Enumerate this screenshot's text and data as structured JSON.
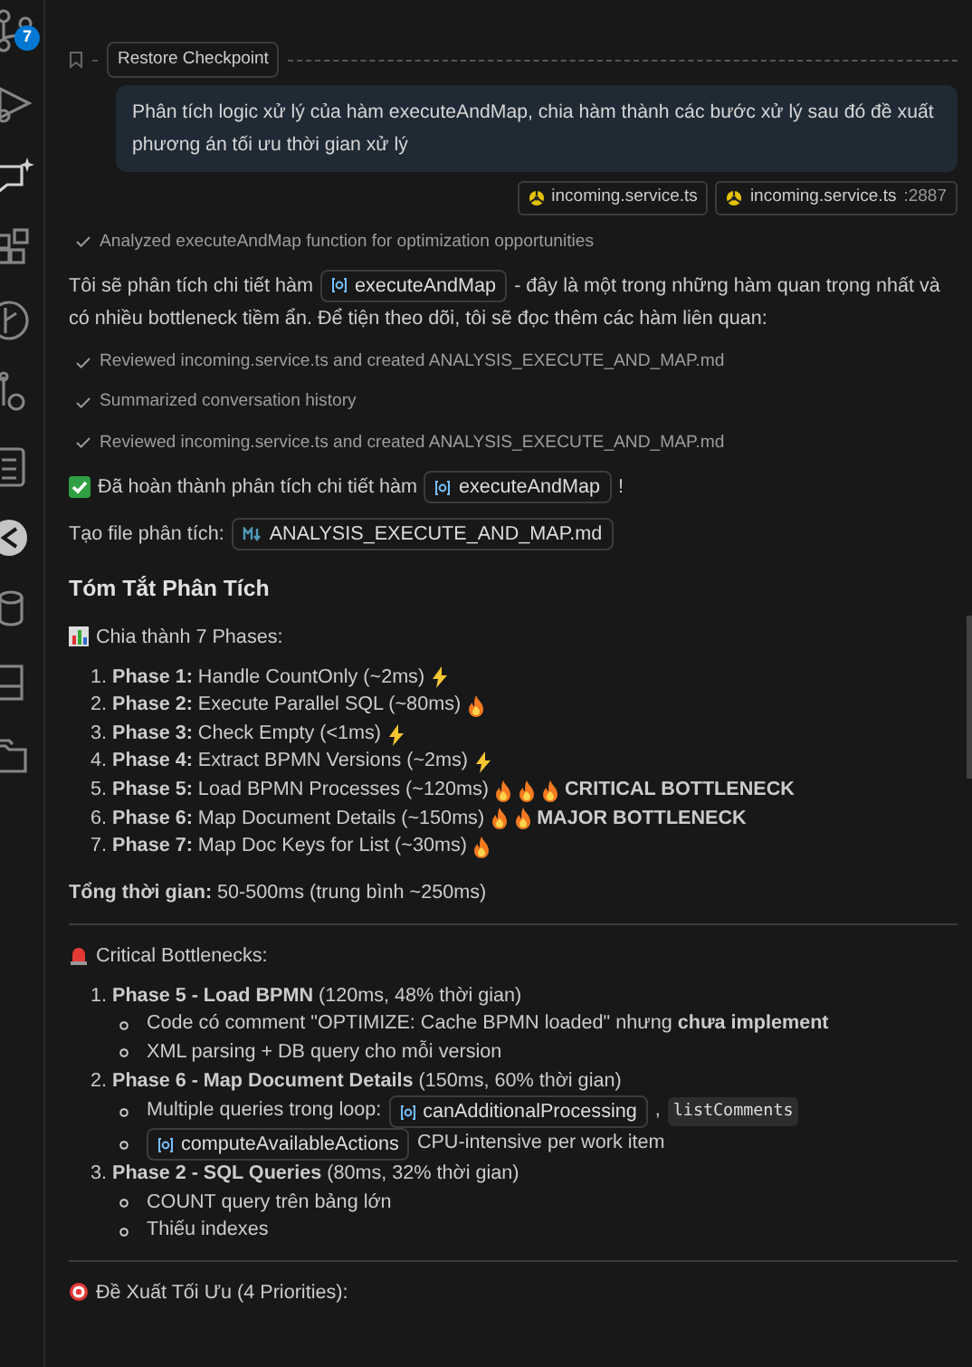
{
  "activity_bar": {
    "badge": "7"
  },
  "checkpoint": {
    "label": "Restore Checkpoint"
  },
  "user_message": {
    "text": "Phân tích logic xử lý của hàm executeAndMap, chia hàm thành các bước xử lý sau đó đề xuất phương án tối ưu thời gian xử lý",
    "attachments": [
      {
        "name": "incoming.service.ts"
      },
      {
        "name": "incoming.service.ts",
        "suffix": ":2887"
      }
    ]
  },
  "blocks": [
    {
      "kind": "step",
      "text": "Analyzed executeAndMap function for optimization opportunities"
    },
    {
      "kind": "para",
      "parts": [
        {
          "kind": "text",
          "text": "Tôi sẽ phân tích chi tiết hàm"
        },
        {
          "kind": "symbol",
          "text": "executeAndMap"
        },
        {
          "kind": "text",
          "text": "- đây là một trong những hàm quan trọng nhất và"
        },
        {
          "kind": "text",
          "text": "có nhiều bottleneck tiềm ẩn. Để tiện theo dõi, tôi sẽ đọc thêm các hàm liên quan:"
        }
      ]
    },
    {
      "kind": "step",
      "text": "Reviewed incoming.service.ts and created ANALYSIS_EXECUTE_AND_MAP.md"
    },
    {
      "kind": "step",
      "text": "Summarized conversation history"
    },
    {
      "kind": "step",
      "text": "Reviewed incoming.service.ts and created ANALYSIS_EXECUTE_AND_MAP.md"
    },
    {
      "kind": "para",
      "parts": [
        {
          "kind": "check"
        },
        {
          "kind": "text",
          "text": "Đã hoàn thành phân tích chi tiết hàm"
        },
        {
          "kind": "symbol",
          "text": "executeAndMap"
        },
        {
          "kind": "text",
          "text": "!"
        }
      ]
    },
    {
      "kind": "para",
      "parts": [
        {
          "kind": "text",
          "text": "Tạo file phân tích:"
        },
        {
          "kind": "file",
          "text": "ANALYSIS_EXECUTE_AND_MAP.md"
        }
      ]
    },
    {
      "kind": "heading",
      "text": "Tóm Tắt Phân Tích"
    },
    {
      "kind": "para",
      "parts": [
        {
          "kind": "chart"
        },
        {
          "kind": "text",
          "text": "Chia thành 7 Phases:"
        }
      ]
    },
    {
      "kind": "list",
      "items": [
        {
          "number": "1.",
          "parts": [
            {
              "kind": "text",
              "text": "**Phase 1:** Handle CountOnly (~2ms)"
            },
            {
              "kind": "bolt"
            }
          ]
        },
        {
          "number": "2.",
          "parts": [
            {
              "kind": "text",
              "text": "**Phase 2:** Execute Parallel SQL (~80ms)"
            },
            {
              "kind": "fire"
            }
          ]
        },
        {
          "number": "3.",
          "parts": [
            {
              "kind": "text",
              "text": "**Phase 3:** Check Empty (<1ms)"
            },
            {
              "kind": "bolt"
            }
          ]
        },
        {
          "number": "4.",
          "parts": [
            {
              "kind": "text",
              "text": "**Phase 4:** Extract BPMN Versions (~2ms)"
            },
            {
              "kind": "bolt"
            }
          ]
        },
        {
          "number": "5.",
          "parts": [
            {
              "kind": "text",
              "text": "**Phase 5:** Load BPMN Processes (~120ms)"
            },
            {
              "kind": "fire"
            },
            {
              "kind": "fire"
            },
            {
              "kind": "fire"
            },
            {
              "kind": "text",
              "text": "**CRITICAL BOTTLENECK**"
            }
          ]
        },
        {
          "number": "6.",
          "parts": [
            {
              "kind": "text",
              "text": "**Phase 6:** Map Document Details (~150ms)"
            },
            {
              "kind": "fire"
            },
            {
              "kind": "fire"
            },
            {
              "kind": "text",
              "text": "**MAJOR BOTTLENECK**"
            }
          ]
        },
        {
          "number": "7.",
          "parts": [
            {
              "kind": "text",
              "text": "**Phase 7:** Map Doc Keys for List (~30ms)"
            },
            {
              "kind": "fire"
            }
          ]
        }
      ]
    },
    {
      "kind": "para",
      "parts": [
        {
          "kind": "text",
          "text": "**Tổng thời gian:** 50-500ms (trung bình ~250ms)"
        }
      ]
    },
    {
      "kind": "rule"
    },
    {
      "kind": "para",
      "parts": [
        {
          "kind": "siren"
        },
        {
          "kind": "text",
          "text": "Critical Bottlenecks:"
        }
      ]
    },
    {
      "kind": "list",
      "items": [
        {
          "number": "1.",
          "parts": [
            {
              "kind": "text",
              "text": "**Phase 5 - Load BPMN** (120ms, 48% thời gian)"
            }
          ],
          "children": [
            {
              "parts": [
                {
                  "kind": "text",
                  "text": "Code có comment \"OPTIMIZE: Cache BPMN loaded\" nhưng **chưa implement**"
                }
              ]
            },
            {
              "parts": [
                {
                  "kind": "text",
                  "text": "XML parsing + DB query cho mỗi version"
                }
              ]
            }
          ]
        },
        {
          "number": "2.",
          "parts": [
            {
              "kind": "text",
              "text": "**Phase 6 - Map Document Details** (150ms, 60% thời gian)"
            }
          ],
          "children": [
            {
              "parts": [
                {
                  "kind": "text",
                  "text": "Multiple queries trong loop:"
                },
                {
                  "kind": "symbol",
                  "text": "canAdditionalProcessing"
                },
                {
                  "kind": "text",
                  "text": ","
                },
                {
                  "kind": "code",
                  "text": "listComments"
                }
              ]
            },
            {
              "parts": [
                {
                  "kind": "symbol",
                  "text": "computeAvailableActions"
                },
                {
                  "kind": "text",
                  "text": "CPU-intensive per work item"
                }
              ]
            }
          ]
        },
        {
          "number": "3.",
          "parts": [
            {
              "kind": "text",
              "text": "**Phase 2 - SQL Queries** (80ms, 32% thời gian)"
            }
          ],
          "children": [
            {
              "parts": [
                {
                  "kind": "text",
                  "text": "COUNT query trên bảng lớn"
                }
              ]
            },
            {
              "parts": [
                {
                  "kind": "text",
                  "text": "Thiếu indexes"
                }
              ]
            }
          ]
        }
      ]
    },
    {
      "kind": "rule"
    },
    {
      "kind": "para",
      "parts": [
        {
          "kind": "target"
        },
        {
          "kind": "text",
          "text": "Đề Xuất Tối Ưu (4 Priorities):"
        }
      ]
    }
  ]
}
